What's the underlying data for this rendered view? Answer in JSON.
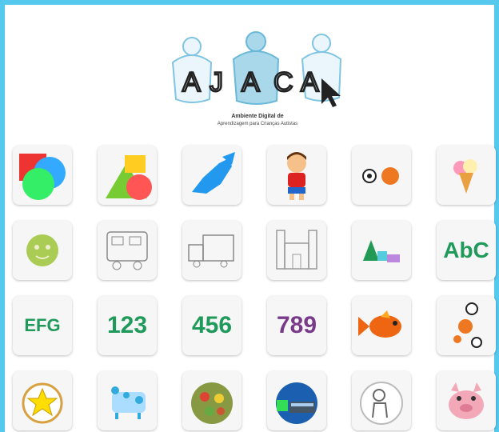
{
  "logo": {
    "letters": [
      "A",
      "J",
      "A",
      "C",
      "A"
    ],
    "subtitle": "Ambiente Digital de",
    "tagline": "Aprendizagem para Crianças Autistas"
  },
  "tiles": [
    {
      "id": "colors",
      "icon": "colors-icon"
    },
    {
      "id": "shapes",
      "icon": "shapes-icon"
    },
    {
      "id": "candy",
      "icon": "candy-icon"
    },
    {
      "id": "boy",
      "icon": "boy-icon"
    },
    {
      "id": "balls",
      "icon": "balls-icon"
    },
    {
      "id": "ice-cream",
      "icon": "ice-cream-icon"
    },
    {
      "id": "face",
      "icon": "face-icon"
    },
    {
      "id": "bus",
      "icon": "bus-icon"
    },
    {
      "id": "truck",
      "icon": "truck-icon"
    },
    {
      "id": "house",
      "icon": "house-icon"
    },
    {
      "id": "letters-abc",
      "icon": "letters-icon"
    },
    {
      "id": "abc",
      "icon": "abc-icon",
      "text": "AbC"
    },
    {
      "id": "efg",
      "icon": "efg-icon",
      "text": "EFG"
    },
    {
      "id": "num-123",
      "icon": "numbers-123-icon",
      "text": "123"
    },
    {
      "id": "num-456",
      "icon": "numbers-456-icon",
      "text": "456"
    },
    {
      "id": "num-789",
      "icon": "numbers-789-icon",
      "text": "789"
    },
    {
      "id": "fish",
      "icon": "fish-icon"
    },
    {
      "id": "soccer",
      "icon": "soccer-icon"
    },
    {
      "id": "star",
      "icon": "star-icon"
    },
    {
      "id": "cow",
      "icon": "cow-icon"
    },
    {
      "id": "food",
      "icon": "food-icon"
    },
    {
      "id": "bus-photo",
      "icon": "bus-photo-icon"
    },
    {
      "id": "person",
      "icon": "person-icon"
    },
    {
      "id": "pig",
      "icon": "pig-icon"
    }
  ],
  "colors": {
    "frame": "#55c8ee",
    "logo_piece": "#a9d8ea",
    "green_text": "#1f9a5a",
    "purple_text": "#7a3a8a"
  }
}
